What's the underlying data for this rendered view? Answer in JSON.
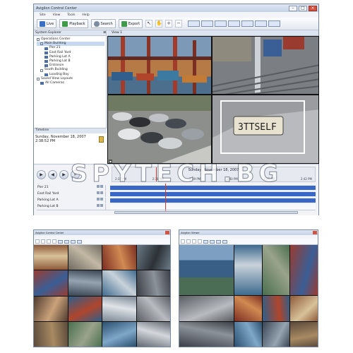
{
  "main_window": {
    "title": "Avigilon Control Center",
    "menu": [
      "Site",
      "View",
      "Tools",
      "Help"
    ],
    "toolbar": {
      "live_label": "Live",
      "playback_label": "Playback",
      "search_label": "Search",
      "export_label": "Export"
    },
    "explorer": {
      "header": "System Explorer",
      "tree": [
        {
          "label": "Operations Center",
          "level": 0
        },
        {
          "label": "Main Building",
          "level": 1,
          "selected": true
        },
        {
          "label": "Pier 21",
          "level": 2
        },
        {
          "label": "East Rail Yard",
          "level": 2
        },
        {
          "label": "Parking Lot A",
          "level": 2
        },
        {
          "label": "Parking Lot B",
          "level": 2
        },
        {
          "label": "Entrance",
          "level": 2
        },
        {
          "label": "South Building",
          "level": 1
        },
        {
          "label": "Loading Bay",
          "level": 2
        },
        {
          "label": "Saved View Layouts",
          "level": 0
        },
        {
          "label": "All Cameras",
          "level": 1
        }
      ]
    },
    "timeline_tab": "Timeline",
    "date_line1": "Sunday, November 18, 2007",
    "date_line2": "2:38:52 PM",
    "view_tab": "View 1",
    "timeline": {
      "date": "Sunday, November 18, 2007",
      "ticks": [
        "2:37 PM",
        "2:38 PM",
        "2:39 PM",
        "2:40 PM",
        "2:41 PM",
        "2:42 PM"
      ],
      "rows": [
        "Pier 21",
        "East Rail Yard",
        "Parking Lot A",
        "Parking Lot B"
      ]
    }
  },
  "watermark": "SPYTECH.BG",
  "small_window_left": {
    "title": "Avigilon Control Center"
  },
  "small_window_right": {
    "title": "Avigilon Viewer"
  },
  "colors": {
    "accent": "#3867c5",
    "cursor": "#d23a2a"
  }
}
